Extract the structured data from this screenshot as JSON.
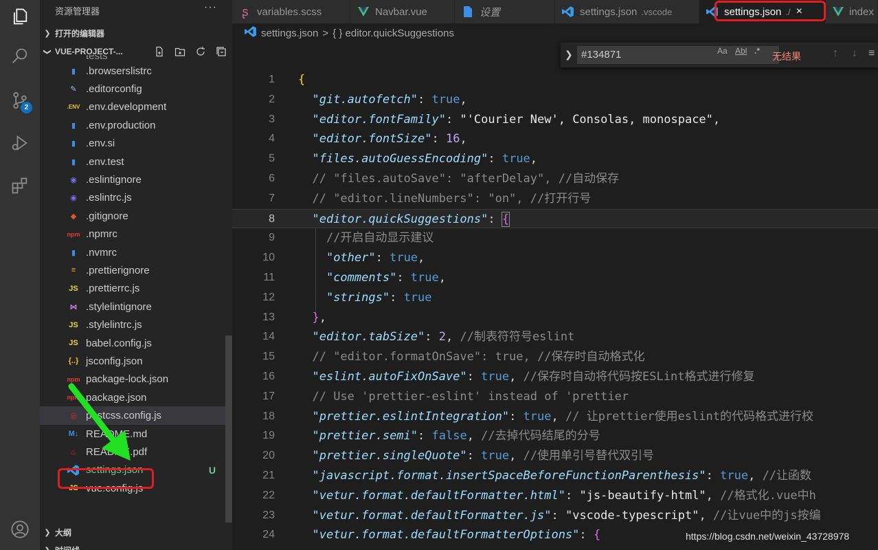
{
  "activity": {
    "icons": [
      "explorer-icon",
      "search-icon",
      "source-control-icon",
      "run-debug-icon",
      "extensions-icon",
      "account-icon"
    ],
    "scm_badge": "2"
  },
  "sidebar": {
    "title": "资源管理器",
    "more": "···",
    "open_editors": "打开的编辑器",
    "project": "VUE-PROJECT-...",
    "partial_item": "tests",
    "files": [
      {
        "name": ".browserslistrc",
        "icon": "file-icon"
      },
      {
        "name": ".editorconfig",
        "icon": "editorconfig-icon"
      },
      {
        "name": ".env.development",
        "icon": "env-icon",
        "label": ".ENV"
      },
      {
        "name": ".env.production",
        "icon": "file-icon"
      },
      {
        "name": ".env.si",
        "icon": "file-icon"
      },
      {
        "name": ".env.test",
        "icon": "file-icon"
      },
      {
        "name": ".eslintignore",
        "icon": "eslint-icon"
      },
      {
        "name": ".eslintrc.js",
        "icon": "eslint-icon"
      },
      {
        "name": ".gitignore",
        "icon": "git-icon"
      },
      {
        "name": ".npmrc",
        "icon": "npm-icon",
        "label": "npm"
      },
      {
        "name": ".nvmrc",
        "icon": "file-icon"
      },
      {
        "name": ".prettierignore",
        "icon": "prettier-icon"
      },
      {
        "name": ".prettierrc.js",
        "icon": "js-icon",
        "label": "JS"
      },
      {
        "name": ".stylelintignore",
        "icon": "stylelint-icon"
      },
      {
        "name": ".stylelintrc.js",
        "icon": "js-icon",
        "label": "JS"
      },
      {
        "name": "babel.config.js",
        "icon": "js-icon",
        "label": "JS"
      },
      {
        "name": "jsconfig.json",
        "icon": "json-icon",
        "label": "{..}"
      },
      {
        "name": "package-lock.json",
        "icon": "npm-icon",
        "label": "npm"
      },
      {
        "name": "package.json",
        "icon": "npm-icon",
        "label": "npm"
      },
      {
        "name": "postcss.config.js",
        "icon": "postcss-icon"
      },
      {
        "name": "README.md",
        "icon": "markdown-icon",
        "label": "M↓"
      },
      {
        "name": "README.pdf",
        "icon": "pdf-icon"
      },
      {
        "name": "settings.json",
        "icon": "vscode-icon",
        "git": "U"
      },
      {
        "name": "vue.config.js",
        "icon": "js-icon",
        "label": "JS"
      }
    ],
    "outline": "大纲",
    "timeline": "时间线"
  },
  "tabs": [
    {
      "label": "variables.scss",
      "icon": "sass-icon",
      "desc": ""
    },
    {
      "label": "Navbar.vue",
      "icon": "vue-icon",
      "desc": ""
    },
    {
      "label": "设置",
      "icon": "file-icon",
      "desc": ""
    },
    {
      "label": "settings.json",
      "icon": "vscode-icon",
      "desc": ".vscode"
    },
    {
      "label": "settings.json",
      "icon": "vscode-icon",
      "desc": "./",
      "close": "×"
    },
    {
      "label": "index",
      "icon": "vue-icon",
      "desc": ""
    }
  ],
  "breadcrumb": {
    "file": "settings.json",
    "sep": ">",
    "symbol": "{ } editor.quickSuggestions"
  },
  "find": {
    "value": "#134871",
    "match_case": "Aa",
    "whole_word": "Abl",
    "regex": ".*",
    "result": "无结果",
    "prev": "↑",
    "next": "↓",
    "menu": "≡"
  },
  "editor": {
    "current_line": 8,
    "lines": [
      "1",
      "2",
      "3",
      "4",
      "5",
      "6",
      "7",
      "8",
      "9",
      "10",
      "11",
      "12",
      "13",
      "14",
      "15",
      "16",
      "17",
      "18",
      "19",
      "20",
      "21",
      "22",
      "23",
      "24"
    ],
    "code": [
      [
        [
          "brace",
          "{"
        ]
      ],
      [
        [
          "p",
          "  "
        ],
        [
          "k",
          "\"git.autofetch\""
        ],
        [
          "p",
          ": "
        ],
        [
          "b",
          "true"
        ],
        [
          "p",
          ","
        ]
      ],
      [
        [
          "p",
          "  "
        ],
        [
          "k",
          "\"editor.fontFamily\""
        ],
        [
          "p",
          ": "
        ],
        [
          "str",
          "\"'Courier New', Consolas, monospace\""
        ],
        [
          "p",
          ","
        ]
      ],
      [
        [
          "p",
          "  "
        ],
        [
          "k",
          "\"editor.fontSize\""
        ],
        [
          "p",
          ": "
        ],
        [
          "n",
          "16"
        ],
        [
          "p",
          ","
        ]
      ],
      [
        [
          "p",
          "  "
        ],
        [
          "k",
          "\"files.autoGuessEncoding\""
        ],
        [
          "p",
          ": "
        ],
        [
          "b",
          "true"
        ],
        [
          "p",
          ","
        ]
      ],
      [
        [
          "p",
          "  "
        ],
        [
          "c",
          "// \"files.autoSave\": \"afterDelay\", //自动保存"
        ]
      ],
      [
        [
          "p",
          "  "
        ],
        [
          "c",
          "// \"editor.lineNumbers\": \"on\", //打开行号"
        ]
      ],
      [
        [
          "p",
          "  "
        ],
        [
          "k",
          "\"editor.quickSuggestions\""
        ],
        [
          "p",
          ": "
        ],
        [
          "brace2",
          "{"
        ]
      ],
      [
        [
          "p",
          "    "
        ],
        [
          "c",
          "//开启自动显示建议"
        ]
      ],
      [
        [
          "p",
          "    "
        ],
        [
          "k",
          "\"other\""
        ],
        [
          "p",
          ": "
        ],
        [
          "b",
          "true"
        ],
        [
          "p",
          ","
        ]
      ],
      [
        [
          "p",
          "    "
        ],
        [
          "k",
          "\"comments\""
        ],
        [
          "p",
          ": "
        ],
        [
          "b",
          "true"
        ],
        [
          "p",
          ","
        ]
      ],
      [
        [
          "p",
          "    "
        ],
        [
          "k",
          "\"strings\""
        ],
        [
          "p",
          ": "
        ],
        [
          "b",
          "true"
        ]
      ],
      [
        [
          "p",
          "  "
        ],
        [
          "brace2",
          "}"
        ],
        [
          "p",
          ","
        ]
      ],
      [
        [
          "p",
          "  "
        ],
        [
          "k",
          "\"editor.tabSize\""
        ],
        [
          "p",
          ": "
        ],
        [
          "n",
          "2"
        ],
        [
          "p",
          ", "
        ],
        [
          "c",
          "//制表符符号eslint"
        ]
      ],
      [
        [
          "p",
          "  "
        ],
        [
          "c",
          "// \"editor.formatOnSave\": true, //保存时自动格式化"
        ]
      ],
      [
        [
          "p",
          "  "
        ],
        [
          "k",
          "\"eslint.autoFixOnSave\""
        ],
        [
          "p",
          ": "
        ],
        [
          "b",
          "true"
        ],
        [
          "p",
          ", "
        ],
        [
          "c",
          "//保存时自动将代码按ESLint格式进行修复"
        ]
      ],
      [
        [
          "p",
          "  "
        ],
        [
          "c",
          "// Use 'prettier-eslint' instead of 'prettier"
        ]
      ],
      [
        [
          "p",
          "  "
        ],
        [
          "k",
          "\"prettier.eslintIntegration\""
        ],
        [
          "p",
          ": "
        ],
        [
          "b",
          "true"
        ],
        [
          "p",
          ", "
        ],
        [
          "c",
          "// 让prettier使用eslint的代码格式进行校"
        ]
      ],
      [
        [
          "p",
          "  "
        ],
        [
          "k",
          "\"prettier.semi\""
        ],
        [
          "p",
          ": "
        ],
        [
          "b",
          "false"
        ],
        [
          "p",
          ", "
        ],
        [
          "c",
          "//去掉代码结尾的分号"
        ]
      ],
      [
        [
          "p",
          "  "
        ],
        [
          "k",
          "\"prettier.singleQuote\""
        ],
        [
          "p",
          ": "
        ],
        [
          "b",
          "true"
        ],
        [
          "p",
          ", "
        ],
        [
          "c",
          "//使用单引号替代双引号"
        ]
      ],
      [
        [
          "p",
          "  "
        ],
        [
          "k",
          "\"javascript.format.insertSpaceBeforeFunctionParenthesis\""
        ],
        [
          "p",
          ": "
        ],
        [
          "b",
          "true"
        ],
        [
          "p",
          ", "
        ],
        [
          "c",
          "//让函数"
        ]
      ],
      [
        [
          "p",
          "  "
        ],
        [
          "k",
          "\"vetur.format.defaultFormatter.html\""
        ],
        [
          "p",
          ": "
        ],
        [
          "str",
          "\"js-beautify-html\""
        ],
        [
          "p",
          ", "
        ],
        [
          "c",
          "//格式化.vue中h"
        ]
      ],
      [
        [
          "p",
          "  "
        ],
        [
          "k",
          "\"vetur.format.defaultFormatter.js\""
        ],
        [
          "p",
          ": "
        ],
        [
          "str",
          "\"vscode-typescript\""
        ],
        [
          "p",
          ", "
        ],
        [
          "c",
          "//让vue中的js按编"
        ]
      ],
      [
        [
          "p",
          "  "
        ],
        [
          "k",
          "\"vetur.format.defaultFormatterOptions\""
        ],
        [
          "p",
          ": "
        ],
        [
          "brace2",
          "{"
        ]
      ]
    ]
  },
  "watermark": "https://blog.csdn.net/weixin_43728978",
  "colors": {
    "accent": "#0e70c0",
    "highlight_red": "#e01e1e",
    "untracked": "#73c991",
    "arrow": "#22e022"
  }
}
